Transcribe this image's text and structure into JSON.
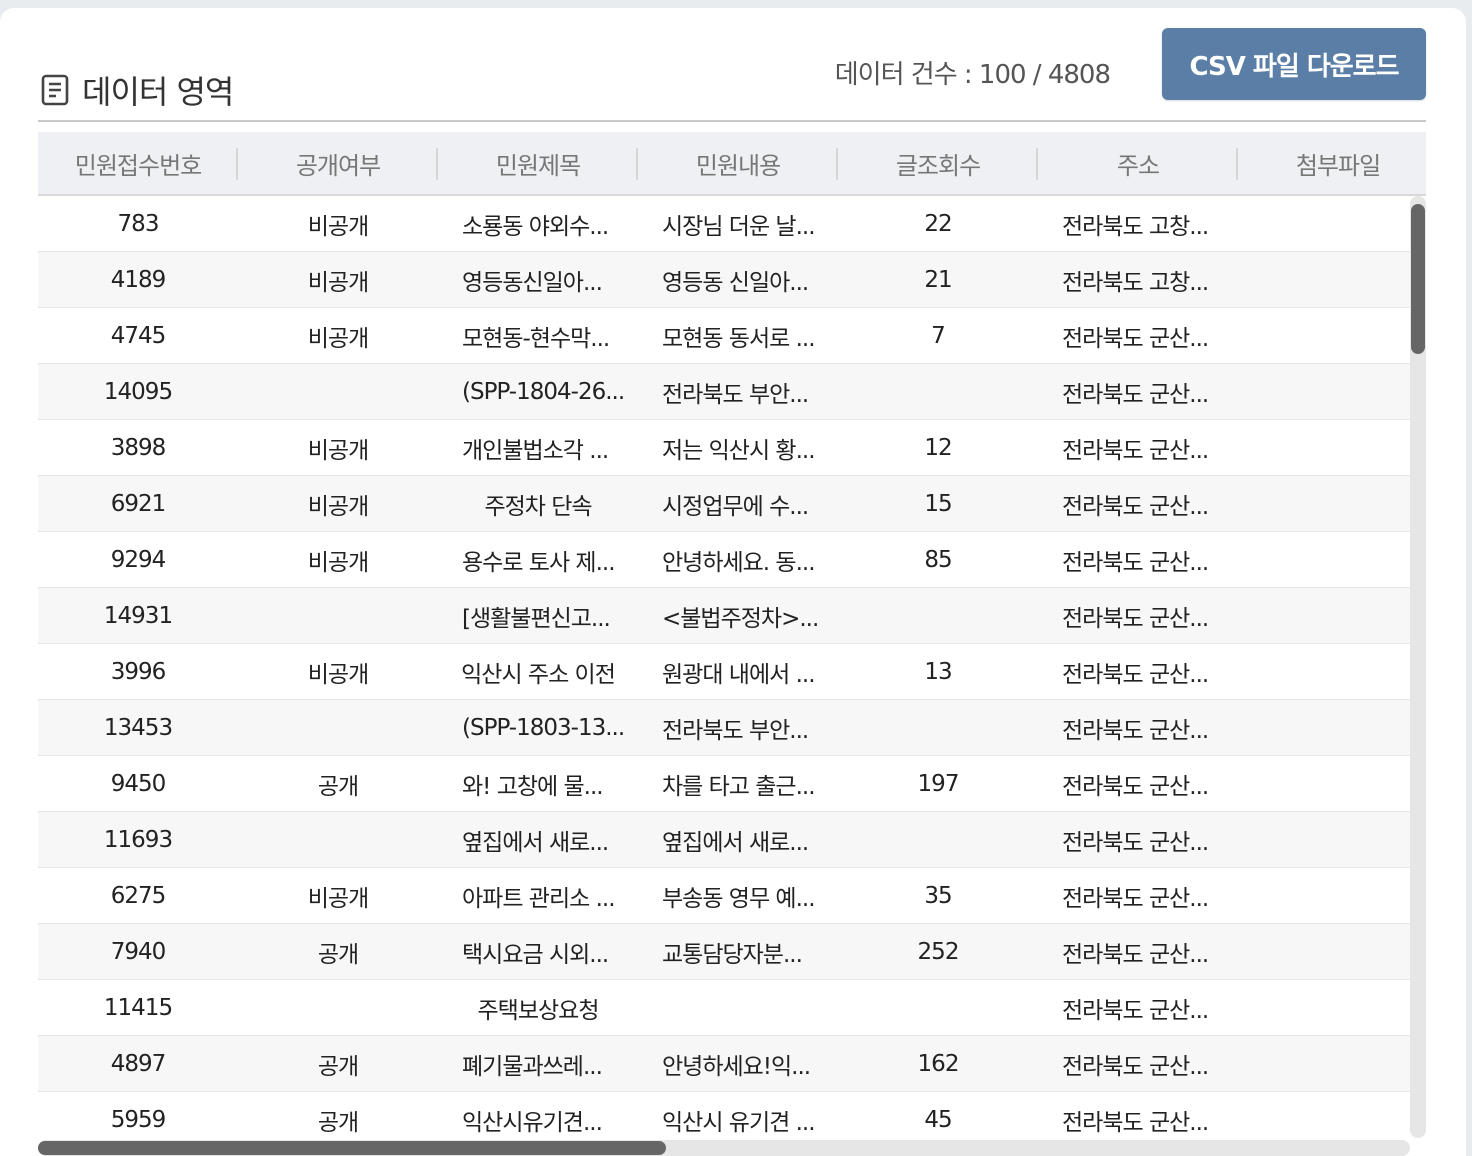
{
  "header": {
    "title": "데이터 영역",
    "count_text": "데이터 건수 : 100 / 4808",
    "download_label": "CSV 파일 다운로드"
  },
  "table": {
    "columns": [
      "민원접수번호",
      "공개여부",
      "민원제목",
      "민원내용",
      "글조회수",
      "주소",
      "첨부파일"
    ],
    "rows": [
      [
        "783",
        "비공개",
        "소룡동 야외수...",
        "시장님 더운 날...",
        "22",
        "전라북도 고창...",
        ""
      ],
      [
        "4189",
        "비공개",
        "영등동신일아...",
        "영등동 신일아...",
        "21",
        "전라북도 고창...",
        ""
      ],
      [
        "4745",
        "비공개",
        "모현동-현수막...",
        "모현동 동서로 ...",
        "7",
        "전라북도 군산...",
        ""
      ],
      [
        "14095",
        "",
        "(SPP-1804-26...",
        "전라북도 부안...",
        "",
        "전라북도 군산...",
        ""
      ],
      [
        "3898",
        "비공개",
        "개인불법소각 ...",
        "저는 익산시 황...",
        "12",
        "전라북도 군산...",
        ""
      ],
      [
        "6921",
        "비공개",
        "주정차 단속",
        "시정업무에 수...",
        "15",
        "전라북도 군산...",
        ""
      ],
      [
        "9294",
        "비공개",
        "용수로 토사 제...",
        "안녕하세요. 동...",
        "85",
        "전라북도 군산...",
        ""
      ],
      [
        "14931",
        "",
        "[생활불편신고...",
        "<불법주정차>...",
        "",
        "전라북도 군산...",
        ""
      ],
      [
        "3996",
        "비공개",
        "익산시 주소 이전",
        "원광대 내에서 ...",
        "13",
        "전라북도 군산...",
        ""
      ],
      [
        "13453",
        "",
        "(SPP-1803-13...",
        "전라북도 부안...",
        "",
        "전라북도 군산...",
        ""
      ],
      [
        "9450",
        "공개",
        "와! 고창에 물...",
        "차를 타고 출근...",
        "197",
        "전라북도 군산...",
        ""
      ],
      [
        "11693",
        "",
        "옆집에서 새로...",
        "옆집에서 새로...",
        "",
        "전라북도 군산...",
        ""
      ],
      [
        "6275",
        "비공개",
        "아파트 관리소 ...",
        "부송동 영무 예...",
        "35",
        "전라북도 군산...",
        ""
      ],
      [
        "7940",
        "공개",
        "택시요금 시외...",
        "교통담당자분...",
        "252",
        "전라북도 군산...",
        ""
      ],
      [
        "11415",
        "",
        "주택보상요청",
        "",
        "",
        "전라북도 군산...",
        ""
      ],
      [
        "4897",
        "공개",
        "폐기물과쓰레...",
        "안녕하세요!익...",
        "162",
        "전라북도 군산...",
        ""
      ],
      [
        "5959",
        "공개",
        "익산시유기견...",
        "익산시 유기견 ...",
        "45",
        "전라북도 군산...",
        ""
      ]
    ]
  }
}
